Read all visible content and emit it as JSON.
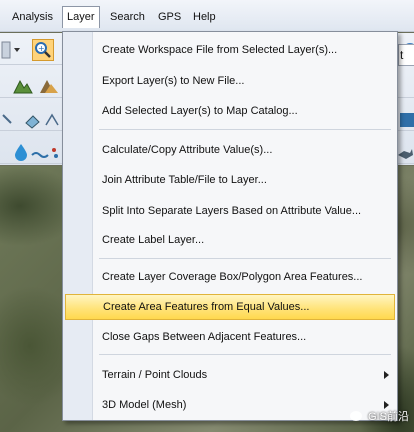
{
  "menubar": {
    "items": [
      {
        "label": "Analysis"
      },
      {
        "label": "Layer"
      },
      {
        "label": "Search"
      },
      {
        "label": "GPS"
      },
      {
        "label": "Help"
      }
    ]
  },
  "toolbar": {
    "partial_field_text": "t up"
  },
  "layer_menu": {
    "items": [
      {
        "label": "Create Workspace File from Selected Layer(s)..."
      },
      {
        "label": "Export Layer(s) to New File..."
      },
      {
        "label": "Add Selected Layer(s) to Map Catalog..."
      },
      {
        "label": "Calculate/Copy Attribute Value(s)..."
      },
      {
        "label": "Join Attribute Table/File to Layer..."
      },
      {
        "label": "Split Into Separate Layers Based on Attribute Value..."
      },
      {
        "label": "Create Label Layer..."
      },
      {
        "label": "Create Layer Coverage Box/Polygon Area Features..."
      },
      {
        "label": "Create Area Features from Equal Values..."
      },
      {
        "label": "Close Gaps Between Adjacent Features..."
      },
      {
        "label": "Terrain / Point Clouds"
      },
      {
        "label": "3D Model (Mesh)"
      }
    ],
    "highlighted_index": 8
  },
  "watermark": {
    "text": "GIS前沿"
  },
  "colors": {
    "highlight": "#ffe47c",
    "menu_bg": "#f6f7f9",
    "gutter": "#e6ebf3"
  }
}
